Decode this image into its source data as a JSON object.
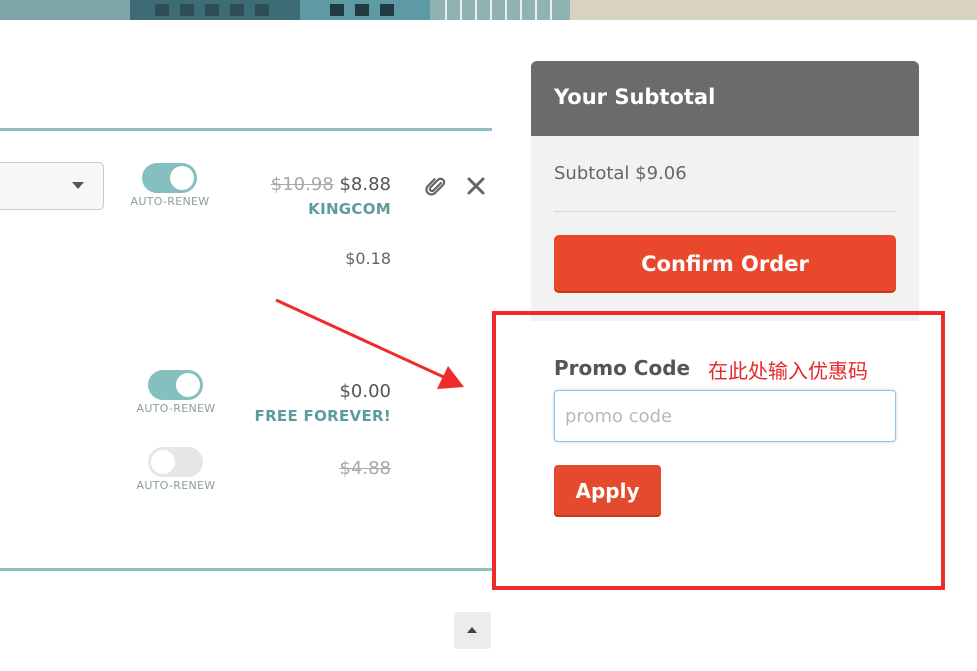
{
  "cart": {
    "rows": [
      {
        "toggle_label": "AUTO-RENEW",
        "toggle_on": true,
        "original_price": "$10.98",
        "price": "$8.88",
        "promo_tag": "KINGCOM",
        "extra_price": "$0.18"
      },
      {
        "toggle_label": "AUTO-RENEW",
        "toggle_on": true,
        "price": "$0.00",
        "promo_tag": "FREE FOREVER!"
      },
      {
        "toggle_label": "AUTO-RENEW",
        "toggle_on": false,
        "original_price": "$4.88"
      }
    ],
    "icons": {
      "attach": "paperclip-icon",
      "remove": "close-icon",
      "select_caret": "chevron-down-icon"
    }
  },
  "summary": {
    "title": "Your Subtotal",
    "subtotal_text": "Subtotal $9.06",
    "confirm_label": "Confirm Order"
  },
  "promo": {
    "label": "Promo Code",
    "annotation": "在此处输入优惠码",
    "placeholder": "promo code",
    "value": "",
    "apply_label": "Apply"
  },
  "colors": {
    "accent_teal": "#86bfbf",
    "confirm_orange": "#e9482d",
    "highlight_red": "#ef2b2b",
    "panel_header": "#6b6b6b"
  },
  "scroll_top_icon": "chevron-up-icon"
}
